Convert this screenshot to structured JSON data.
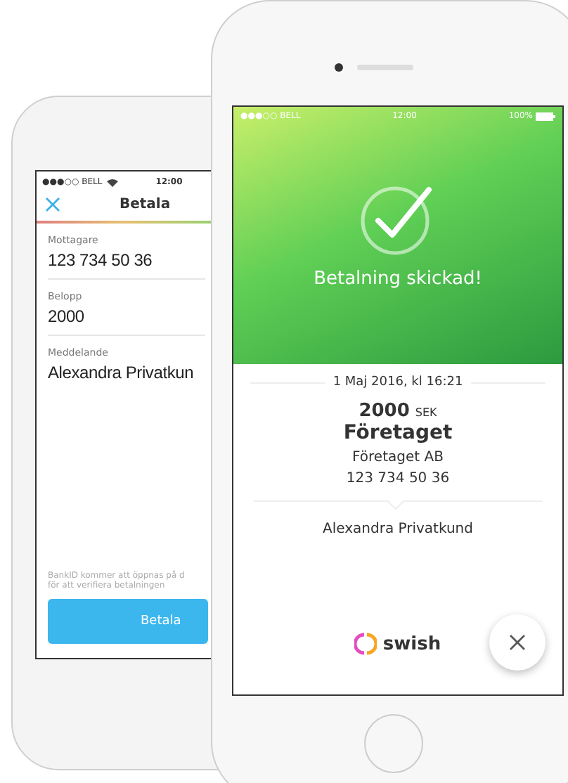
{
  "back_screen": {
    "status_bar": {
      "carrier": "●●●○○ BELL",
      "time": "12:00"
    },
    "nav": {
      "title": "Betala"
    },
    "fields": [
      {
        "label": "Mottagare",
        "value": "123 734 50 36"
      },
      {
        "label": "Belopp",
        "value": "2000"
      },
      {
        "label": "Meddelande",
        "value": "Alexandra Privatkun"
      }
    ],
    "notice": [
      "BankID kommer att öppnas på d",
      "för att verifiera betalningen"
    ],
    "button": "Betala"
  },
  "front_screen": {
    "status_bar": {
      "carrier": "●●●○○ BELL",
      "time": "12:00",
      "battery": "100%"
    },
    "banner": {
      "title": "Betalning skickad!"
    },
    "receipt": {
      "date": "1 Maj 2016, kl 16:21",
      "amount": "2000",
      "currency": "SEK",
      "recipient": "Företaget",
      "company": "Företaget AB",
      "number": "123 734 50 36",
      "message": "Alexandra Privatkund"
    },
    "brand": "swish"
  }
}
